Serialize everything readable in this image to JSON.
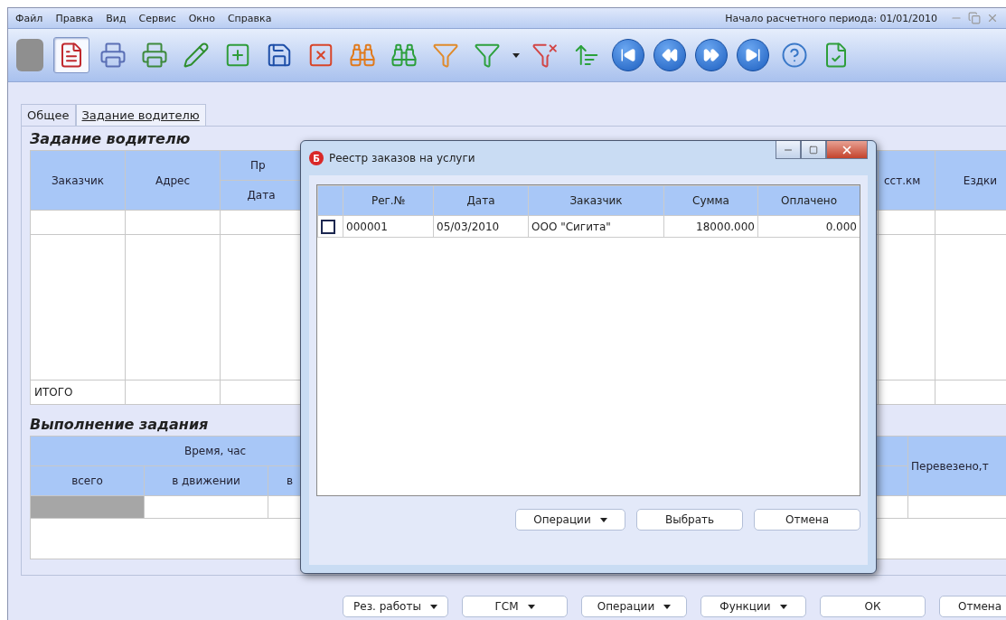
{
  "menu": [
    "Файл",
    "Правка",
    "Вид",
    "Сервис",
    "Окно",
    "Справка"
  ],
  "period": "Начало расчетного периода: 01/01/2010",
  "toolbar": [
    {
      "kind": "blank",
      "selected": false
    },
    {
      "kind": "report",
      "selected": true
    },
    {
      "kind": "print",
      "selected": false
    },
    {
      "kind": "print-check",
      "selected": false
    },
    {
      "kind": "edit",
      "selected": false
    },
    {
      "kind": "add",
      "selected": false
    },
    {
      "kind": "save",
      "selected": false
    },
    {
      "kind": "delete",
      "selected": false
    },
    {
      "kind": "find-orange",
      "selected": false
    },
    {
      "kind": "find-green",
      "selected": false
    },
    {
      "kind": "filter-orange",
      "selected": false
    },
    {
      "kind": "filter-green",
      "selected": false
    },
    {
      "kind": "dropdown",
      "selected": false
    },
    {
      "kind": "filter-clear",
      "selected": false
    },
    {
      "kind": "sort",
      "selected": false
    },
    {
      "kind": "first",
      "selected": false
    },
    {
      "kind": "prev",
      "selected": false
    },
    {
      "kind": "next",
      "selected": false
    },
    {
      "kind": "last",
      "selected": false
    },
    {
      "kind": "help",
      "selected": false
    },
    {
      "kind": "doc-check",
      "selected": false
    }
  ],
  "tabs": [
    {
      "label": "Общее",
      "selected": false
    },
    {
      "label": "Задание водителю",
      "selected": true
    }
  ],
  "task": {
    "title": "Задание водителю",
    "columns": [
      "Заказчик",
      "Адрес"
    ],
    "group": "Пр",
    "subcolumn": "Дата",
    "right_columns": [
      "сст.км",
      "Ездки"
    ],
    "total_label": "ИТОГО"
  },
  "execution": {
    "title": "Выполнение задания",
    "group": "Время, час",
    "subcolumns": [
      "всего",
      "в движении",
      "в"
    ],
    "right_column": "Перевезено,т"
  },
  "buttons": [
    {
      "label": "Рез. работы",
      "dropdown": true
    },
    {
      "label": "ГСМ",
      "dropdown": true
    },
    {
      "label": "Операции",
      "dropdown": true
    },
    {
      "label": "Функции",
      "dropdown": true
    },
    {
      "label": "ОК",
      "dropdown": false
    },
    {
      "label": "Отмена",
      "dropdown": false
    }
  ],
  "dialog": {
    "title": "Реестр заказов на услуги",
    "icon_letter": "Б",
    "columns": [
      "Рег.№",
      "Дата",
      "Заказчик",
      "Сумма",
      "Оплачено"
    ],
    "rows": [
      {
        "checked": false,
        "cells": [
          "000001",
          "05/03/2010",
          "ООО \"Сигита\"",
          "18000.000",
          "0.000"
        ]
      }
    ],
    "buttons": [
      {
        "label": "Операции",
        "dropdown": true
      },
      {
        "label": "Выбрать",
        "dropdown": false
      },
      {
        "label": "Отмена",
        "dropdown": false
      }
    ]
  }
}
